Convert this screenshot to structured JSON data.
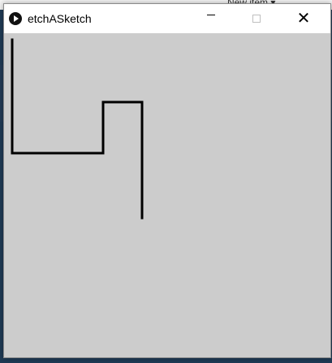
{
  "background_app": {
    "toolbar_label": "New item ▾"
  },
  "window": {
    "title": "etchASketch",
    "controls": {
      "minimize_icon": "minimize-icon",
      "maximize_icon": "maximize-icon",
      "close_icon": "close-icon"
    },
    "canvas": {
      "background": "#cccccc",
      "stroke_color": "#000000",
      "path": "sketch line"
    }
  }
}
